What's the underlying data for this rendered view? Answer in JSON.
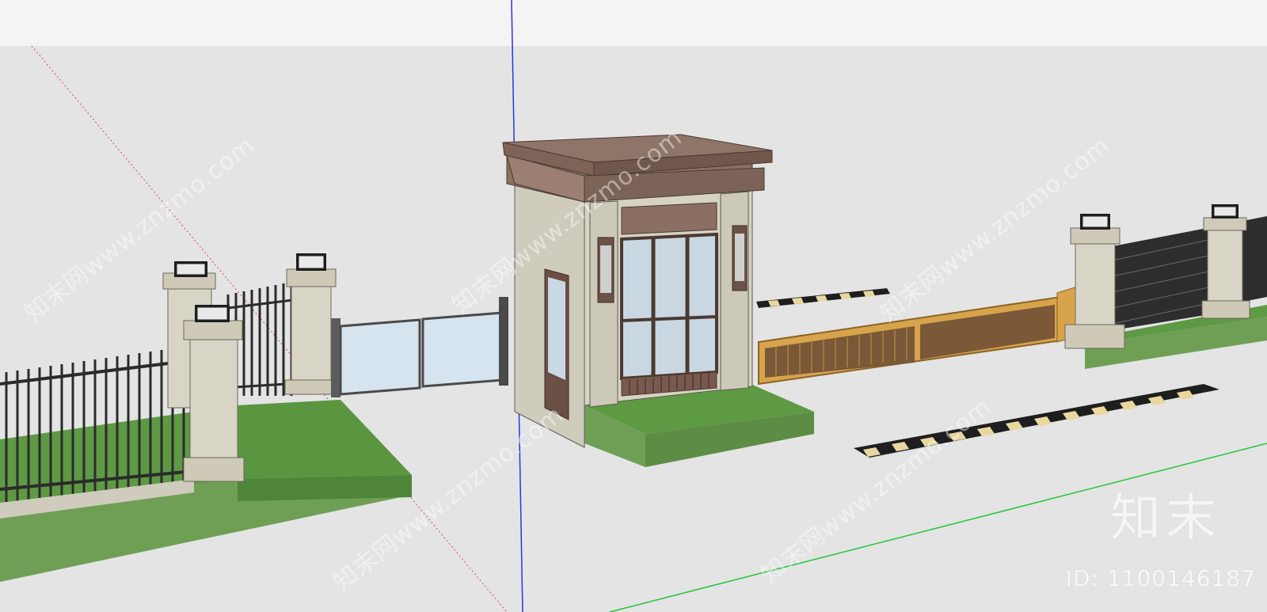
{
  "app": {
    "name": "SketchUp-style 3D viewport"
  },
  "scene": {
    "subject": "guard-house-entrance-gate",
    "colors": {
      "sky": "#f4f4f4",
      "ground": "#e4e4e4",
      "lawn": "#5e9944",
      "lawn_side": "#6f9f55",
      "stone": "#d4d0c2",
      "roof": "#8a6f62",
      "fence": "#2b2b2b",
      "boom_gold": "#d7a44c",
      "axis_blue": "#2a34e0",
      "axis_green": "#21c63b",
      "axis_red": "#d64b4b"
    }
  },
  "watermark": {
    "site": "知末网www.znzmo.com",
    "logo": "知末",
    "id_label": "ID: 1100146187"
  }
}
